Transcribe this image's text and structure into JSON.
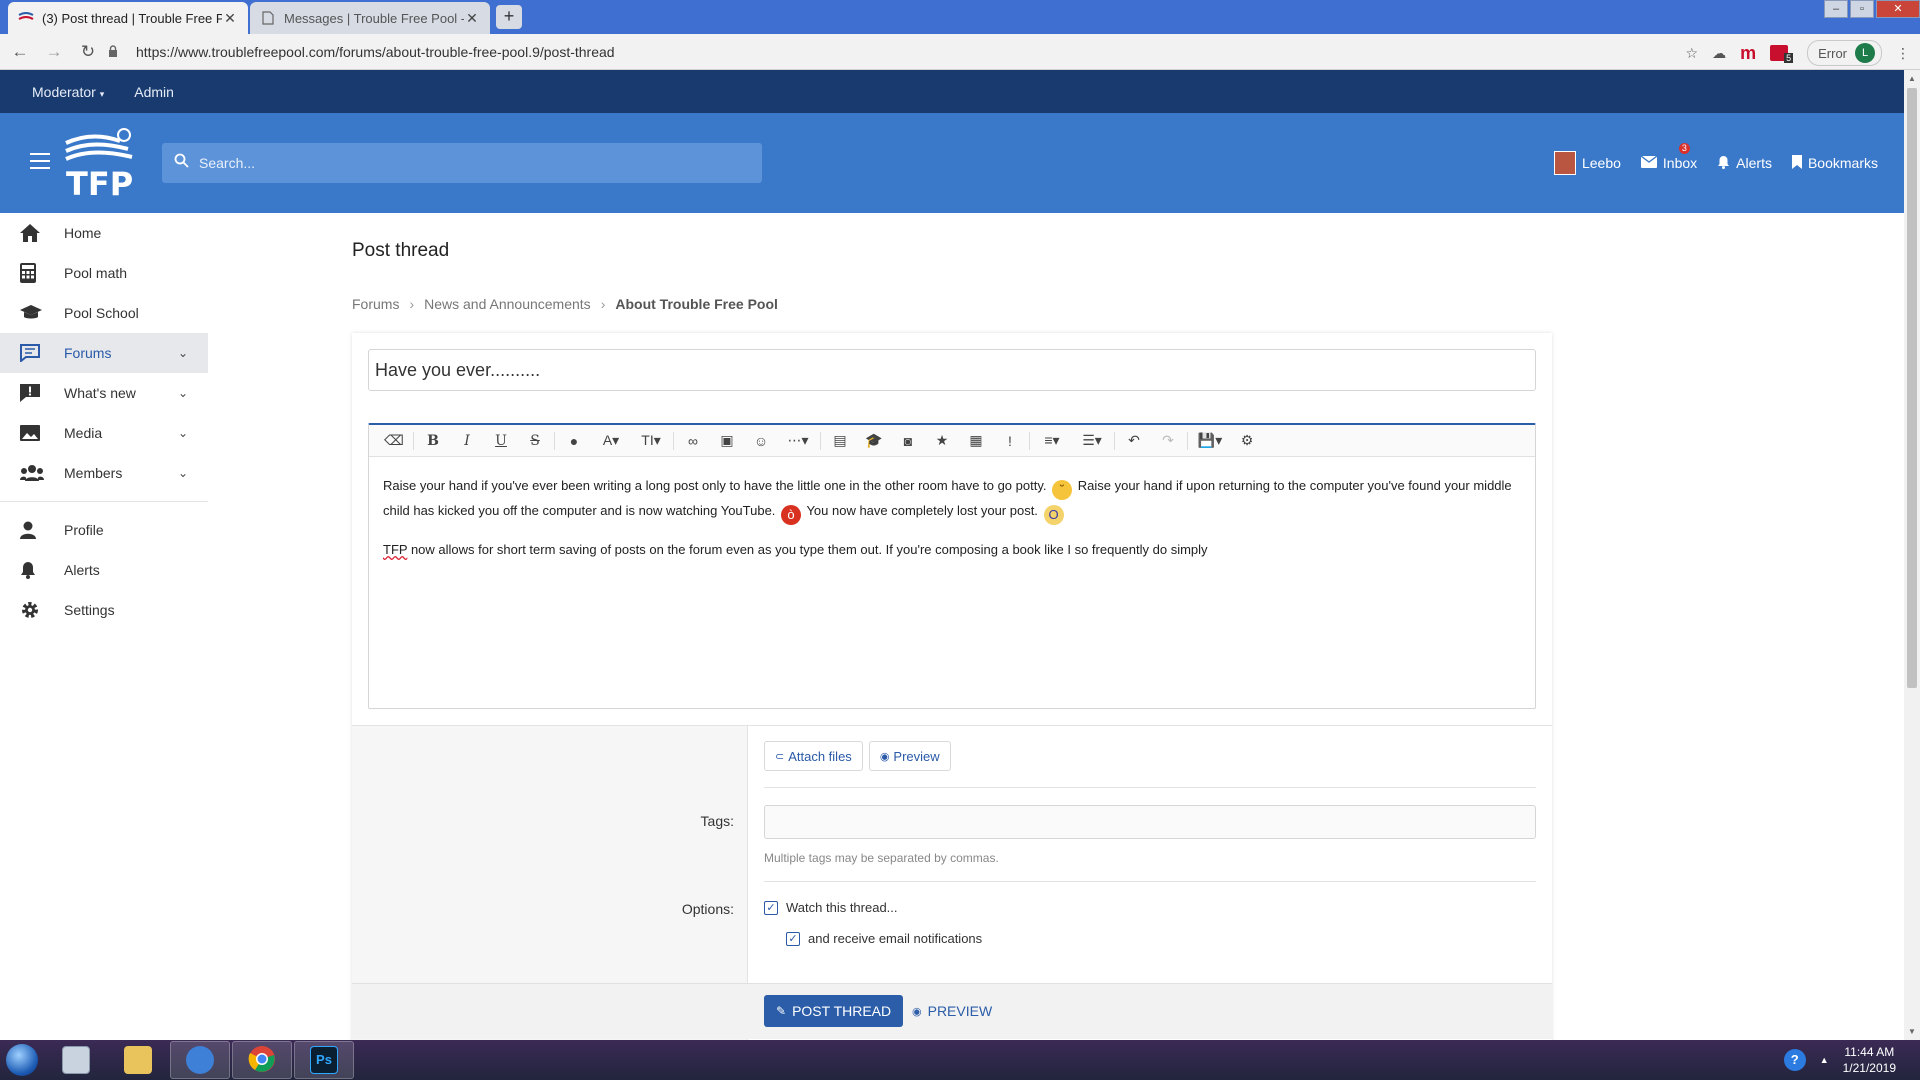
{
  "browser": {
    "tabs": [
      {
        "title": "(3) Post thread | Trouble Free Po",
        "active": true
      },
      {
        "title": "Messages | Trouble Free Pool - A",
        "active": false
      }
    ],
    "url": "https://www.troublefreepool.com/forums/about-trouble-free-pool.9/post-thread",
    "error_label": "Error",
    "profile_initial": "L",
    "ext_badge": "5"
  },
  "modbar": {
    "moderator": "Moderator",
    "admin": "Admin"
  },
  "header": {
    "logo_text": "TFP",
    "search_placeholder": "Search...",
    "user": "Leebo",
    "inbox": "Inbox",
    "inbox_badge": "3",
    "alerts": "Alerts",
    "bookmarks": "Bookmarks"
  },
  "sidebar": {
    "items": [
      {
        "label": "Home",
        "icon": "home-icon"
      },
      {
        "label": "Pool math",
        "icon": "calculator-icon"
      },
      {
        "label": "Pool School",
        "icon": "graduation-cap-icon"
      },
      {
        "label": "Forums",
        "icon": "comment-icon",
        "active": true
      },
      {
        "label": "What's new",
        "icon": "comment-exclamation-icon"
      },
      {
        "label": "Media",
        "icon": "image-icon"
      },
      {
        "label": "Members",
        "icon": "users-icon"
      }
    ],
    "secondary": [
      {
        "label": "Profile",
        "icon": "user-icon"
      },
      {
        "label": "Alerts",
        "icon": "bell-icon"
      },
      {
        "label": "Settings",
        "icon": "gear-icon"
      }
    ]
  },
  "page": {
    "title": "Post thread",
    "breadcrumb": [
      "Forums",
      "News and Announcements",
      "About Trouble Free Pool"
    ]
  },
  "form": {
    "thread_title": "Have you ever..........",
    "body": {
      "p1_a": "Raise your hand if you've ever been writing a long post only to have the little one in the other room have to go potty.",
      "p1_b": "Raise your hand if upon returning to the computer you've found your middle child has kicked you off the computer and is now watching YouTube.",
      "p1_c": "You now have completely lost your post.",
      "p2_spell": "TFP",
      "p2_rest": " now allows for short term saving of posts on the forum even as you type them out.  If you're composing a book like I so frequently do simply"
    },
    "attach_files": "Attach files",
    "preview": "Preview",
    "tags_label": "Tags:",
    "tags_hint": "Multiple tags may be separated by commas.",
    "options_label": "Options:",
    "watch_thread": "Watch this thread...",
    "email_notifications": "and receive email notifications",
    "post_thread_button": "POST THREAD",
    "preview_button": "PREVIEW"
  },
  "taskbar": {
    "time": "11:44 AM",
    "date": "1/21/2019",
    "photoshop_label": "Ps"
  },
  "colors": {
    "modbar": "#183a6e",
    "header": "#3a78c9",
    "accent": "#2c5da8"
  }
}
